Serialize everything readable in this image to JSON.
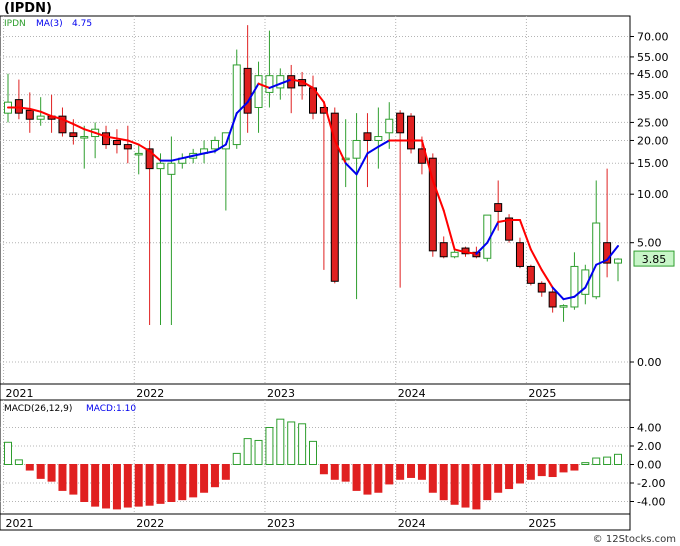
{
  "title": "(IPDN)",
  "watermark": "© 12Stocks.com",
  "colors": {
    "up": "#2e9e2e",
    "down": "#e02020",
    "ma_down": "#ff0000",
    "ma_up": "#0000ee",
    "grid": "#b4b4b4",
    "last_fill": "#c8f5c8"
  },
  "chart_data": [
    {
      "type": "candlestick",
      "ylabel": "",
      "scale": "log",
      "legend": {
        "ticker": "IPDN",
        "ma_label": "MA(3)",
        "ma_value": "4.75"
      },
      "last_price_label": "3.85",
      "yticks": [
        "70.00",
        "55.00",
        "45.00",
        "35.00",
        "25.00",
        "20.00",
        "15.00",
        "10.00",
        "5.00",
        "0.00"
      ],
      "xticks": [
        "2021",
        "2022",
        "2023",
        "2024",
        "2025"
      ],
      "candles": [
        {
          "o": 28,
          "h": 45,
          "l": 25,
          "c": 32
        },
        {
          "o": 33,
          "h": 42,
          "l": 26,
          "c": 28
        },
        {
          "o": 29,
          "h": 36,
          "l": 22,
          "c": 26
        },
        {
          "o": 26,
          "h": 34,
          "l": 24,
          "c": 27
        },
        {
          "o": 27,
          "h": 35,
          "l": 22,
          "c": 26
        },
        {
          "o": 27,
          "h": 30,
          "l": 21,
          "c": 22
        },
        {
          "o": 22,
          "h": 26,
          "l": 19,
          "c": 21
        },
        {
          "o": 21,
          "h": 24,
          "l": 14,
          "c": 21
        },
        {
          "o": 21,
          "h": 25,
          "l": 16,
          "c": 23
        },
        {
          "o": 22,
          "h": 24,
          "l": 18,
          "c": 19
        },
        {
          "o": 20,
          "h": 23,
          "l": 17,
          "c": 19
        },
        {
          "o": 19,
          "h": 24,
          "l": 15,
          "c": 18
        },
        {
          "o": 17,
          "h": 19,
          "l": 13,
          "c": 17
        },
        {
          "o": 18,
          "h": 20,
          "l": 0.9,
          "c": 14
        },
        {
          "o": 14,
          "h": 17,
          "l": 0.9,
          "c": 15
        },
        {
          "o": 13,
          "h": 21,
          "l": 0.9,
          "c": 15
        },
        {
          "o": 15,
          "h": 17,
          "l": 14,
          "c": 16
        },
        {
          "o": 16,
          "h": 18,
          "l": 15,
          "c": 17
        },
        {
          "o": 17,
          "h": 20,
          "l": 15,
          "c": 18
        },
        {
          "o": 18,
          "h": 21,
          "l": 17,
          "c": 20
        },
        {
          "o": 18,
          "h": 22,
          "l": 8,
          "c": 22
        },
        {
          "o": 19,
          "h": 60,
          "l": 18,
          "c": 50
        },
        {
          "o": 48,
          "h": 80,
          "l": 22,
          "c": 28
        },
        {
          "o": 30,
          "h": 52,
          "l": 22,
          "c": 44
        },
        {
          "o": 36,
          "h": 75,
          "l": 30,
          "c": 44
        },
        {
          "o": 38,
          "h": 48,
          "l": 33,
          "c": 44
        },
        {
          "o": 44,
          "h": 50,
          "l": 28,
          "c": 38
        },
        {
          "o": 42,
          "h": 46,
          "l": 33,
          "c": 39
        },
        {
          "o": 38,
          "h": 44,
          "l": 26,
          "c": 28
        },
        {
          "o": 30,
          "h": 32,
          "l": 3.2,
          "c": 28
        },
        {
          "o": 28,
          "h": 30,
          "l": 2.5,
          "c": 2.6
        },
        {
          "o": 16,
          "h": 26,
          "l": 11,
          "c": 16
        },
        {
          "o": 16,
          "h": 28,
          "l": 1.8,
          "c": 20
        },
        {
          "o": 22,
          "h": 28,
          "l": 11,
          "c": 20
        },
        {
          "o": 20,
          "h": 30,
          "l": 14,
          "c": 21
        },
        {
          "o": 22,
          "h": 32,
          "l": 18,
          "c": 26
        },
        {
          "o": 28,
          "h": 29,
          "l": 2.3,
          "c": 22
        },
        {
          "o": 27,
          "h": 28,
          "l": 17,
          "c": 18
        },
        {
          "o": 18,
          "h": 21,
          "l": 13,
          "c": 15
        },
        {
          "o": 16,
          "h": 17,
          "l": 4,
          "c": 4.4
        },
        {
          "o": 5,
          "h": 5.5,
          "l": 3.9,
          "c": 4
        },
        {
          "o": 4,
          "h": 4.6,
          "l": 3.9,
          "c": 4.3
        },
        {
          "o": 4.6,
          "h": 4.7,
          "l": 4,
          "c": 4.2
        },
        {
          "o": 4.3,
          "h": 4.7,
          "l": 3.9,
          "c": 4
        },
        {
          "o": 3.9,
          "h": 7.5,
          "l": 3.7,
          "c": 7.5
        },
        {
          "o": 8.8,
          "h": 12,
          "l": 6,
          "c": 7.9
        },
        {
          "o": 7.2,
          "h": 7.6,
          "l": 5,
          "c": 5.2
        },
        {
          "o": 5,
          "h": 5.4,
          "l": 3.3,
          "c": 3.4
        },
        {
          "o": 3.4,
          "h": 3.5,
          "l": 2.4,
          "c": 2.5
        },
        {
          "o": 2.5,
          "h": 2.6,
          "l": 1.9,
          "c": 2.1
        },
        {
          "o": 2.1,
          "h": 2.3,
          "l": 1.3,
          "c": 1.5
        },
        {
          "o": 1.5,
          "h": 1.6,
          "l": 1.0,
          "c": 1.55
        },
        {
          "o": 1.5,
          "h": 4.3,
          "l": 1.4,
          "c": 3.4
        },
        {
          "o": 2,
          "h": 3.5,
          "l": 1.6,
          "c": 3.2
        },
        {
          "o": 1.9,
          "h": 12,
          "l": 1.8,
          "c": 6.7
        },
        {
          "o": 5,
          "h": 14,
          "l": 2.8,
          "c": 3.6
        },
        {
          "o": 3.6,
          "h": 3.9,
          "l": 2.6,
          "c": 3.85
        }
      ],
      "ma": [
        30,
        30,
        29.5,
        28.5,
        27,
        26,
        24.5,
        23,
        22,
        21,
        20.5,
        20,
        19,
        17.5,
        15.5,
        15.5,
        16,
        16.5,
        17,
        17.5,
        19,
        28,
        32,
        40,
        38,
        40,
        42,
        41,
        38,
        32,
        20,
        15,
        13,
        17,
        18.5,
        20,
        20,
        20,
        20,
        12,
        8,
        4.5,
        4.3,
        4.2,
        5,
        6.8,
        7,
        7,
        4.5,
        3.2,
        2.3,
        1.8,
        1.9,
        2.3,
        3.5,
        3.8,
        4.75
      ],
      "ma_color_flags": [
        "d",
        "d",
        "d",
        "d",
        "d",
        "d",
        "d",
        "d",
        "d",
        "d",
        "d",
        "d",
        "d",
        "d",
        "d",
        "u",
        "u",
        "u",
        "u",
        "u",
        "u",
        "u",
        "u",
        "u",
        "d",
        "u",
        "u",
        "d",
        "d",
        "d",
        "d",
        "d",
        "u",
        "u",
        "u",
        "u",
        "d",
        "d",
        "d",
        "d",
        "d",
        "d",
        "d",
        "d",
        "u",
        "u",
        "d",
        "d",
        "d",
        "d",
        "d",
        "u",
        "u",
        "u",
        "u",
        "u",
        "u"
      ]
    },
    {
      "type": "bar",
      "legend": {
        "label": "MACD(26,12,9)",
        "value_label": "MACD:1.10"
      },
      "yticks": [
        "4.00",
        "2.00",
        "0.00",
        "-2.00",
        "-4.00"
      ],
      "ylim": [
        -5.4,
        5.2
      ],
      "xticks": [
        "2021",
        "2022",
        "2023",
        "2024",
        "2025"
      ],
      "values": [
        2.4,
        0.5,
        -0.6,
        -1.5,
        -1.8,
        -2.8,
        -3.2,
        -4.0,
        -4.5,
        -4.7,
        -4.8,
        -4.6,
        -4.5,
        -4.4,
        -4.2,
        -4.0,
        -3.8,
        -3.5,
        -3.0,
        -2.4,
        -1.6,
        1.2,
        2.8,
        2.6,
        4.0,
        4.9,
        4.6,
        4.4,
        2.5,
        -1.0,
        -1.6,
        -1.8,
        -2.8,
        -3.2,
        -3.0,
        -2.1,
        -1.6,
        -1.4,
        -1.6,
        -3.0,
        -3.8,
        -4.3,
        -4.6,
        -4.8,
        -3.8,
        -3.0,
        -2.6,
        -2.0,
        -1.6,
        -1.2,
        -1.3,
        -0.8,
        -0.6,
        0.2,
        0.7,
        0.8,
        1.1
      ]
    }
  ]
}
